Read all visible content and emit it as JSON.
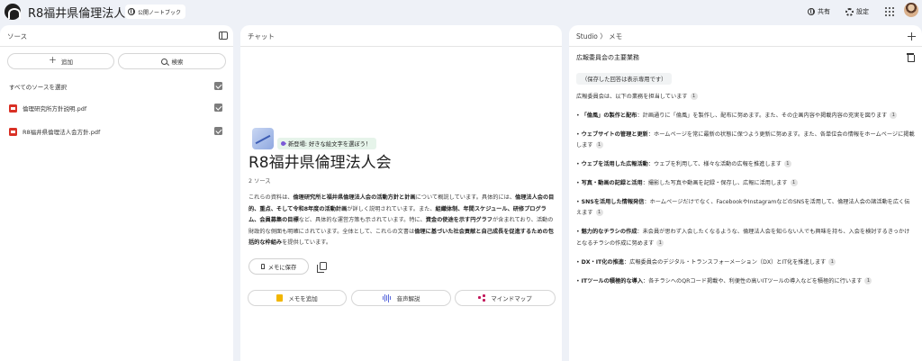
{
  "app": {
    "title": "R8福井県倫理法人会",
    "visibility_label": "公開ノートブック"
  },
  "topbar": {
    "share_label": "共有",
    "settings_label": "設定"
  },
  "sources": {
    "header": "ソース",
    "add_label": "追加",
    "search_label": "検索",
    "select_all_label": "すべてのソースを選択",
    "items": [
      {
        "name": "倫理研究所方針説明.pdf"
      },
      {
        "name": "R8福井県倫理法人会方針.pdf"
      }
    ]
  },
  "chat": {
    "header": "チャット",
    "new_feature_label": "新登場: 好きな絵文字を選ぼう！",
    "notebook_title": "R8福井県倫理法人会",
    "source_count": "2 ソース",
    "summary": [
      {
        "text": "これらの資料は、",
        "bold": false
      },
      {
        "text": "倫理研究所と福井県倫理法人会の活動方針と計画",
        "bold": true
      },
      {
        "text": "について概説しています。具体的には、",
        "bold": false
      },
      {
        "text": "倫理法人会の目的、重点、そして令和8年度の活動計画",
        "bold": true
      },
      {
        "text": "が詳しく説明されています。また、",
        "bold": false
      },
      {
        "text": "組織体制、年間スケジュール、研修プログラム、会員募集の目標",
        "bold": true
      },
      {
        "text": "など、具体的な運営方策も示されています。特に、",
        "bold": false
      },
      {
        "text": "資金の使途を示す円グラフ",
        "bold": true
      },
      {
        "text": "が含まれており、活動の財政的な側面も明確にされています。全体として、これらの文書は",
        "bold": false
      },
      {
        "text": "倫理に基づいた社会貢献と自己成長を促進するための包括的な枠組み",
        "bold": true
      },
      {
        "text": "を提供しています。",
        "bold": false
      }
    ],
    "save_to_note_label": "メモに保存",
    "add_note_label": "メモを追加",
    "audio_overview_label": "音声解説",
    "mind_map_label": "マインドマップ"
  },
  "studio": {
    "breadcrumb": "Studio  〉 メモ",
    "note_title": "広報委員会の主要業務",
    "readonly_label": "（保存した回答は表示専用です）",
    "intro": "広報委員会は、以下の業務を担当しています",
    "cite_number": "1",
    "bullets": [
      {
        "title": "「倫風」の製作と配布",
        "text": "：計画通りに「倫風」を製作し、配布に努めます。また、その企画内容や掲載内容の充実を図ります"
      },
      {
        "title": "ウェブサイトの管理と更新",
        "text": "：ホームページを常に最新の状態に保つよう更新に努めます。また、各単位会の情報をホームページに掲載します"
      },
      {
        "title": "ウェブを活用した広報活動",
        "text": "：ウェブを利用して、様々な活動の広報を推進します"
      },
      {
        "title": "写真・動画の記録と活用",
        "text": "：撮影した写真や動画を記録・保存し、広報に活用します"
      },
      {
        "title": "SNSを活用した情報発信",
        "text": "：ホームページだけでなく、FacebookやInstagramなどのSNSを活用して、倫理法人会の諸活動を広く伝えます"
      },
      {
        "title": "魅力的なチラシの作成",
        "text": "：未会員が思わず入会したくなるような、倫理法人会を知らない人でも興味を持ち、入会を検討するきっかけとなるチラシの作成に努めます"
      },
      {
        "title": "DX・IT化の推進",
        "text": "：広報委員会のデジタル・トランスフォーメーション（DX）とIT化を推進します"
      },
      {
        "title": "ITツールの積極的な導入",
        "text": "：各チラシへのQRコード掲載や、利便性の高いITツールの導入などを積極的に行います"
      }
    ]
  }
}
